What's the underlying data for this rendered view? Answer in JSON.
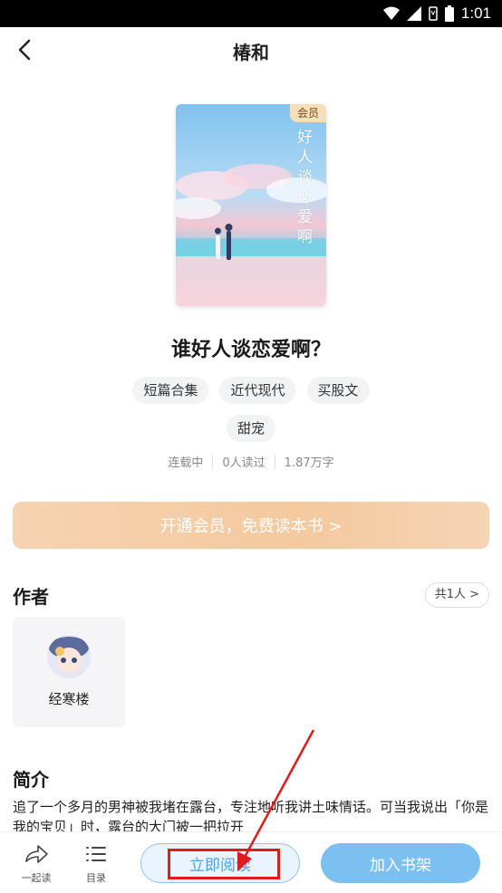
{
  "status_bar": {
    "time": "1:01",
    "icons": [
      "wifi-icon",
      "signal-icon",
      "sim-icon",
      "battery-icon"
    ]
  },
  "header": {
    "title": "椿和",
    "back_icon": "back-arrow-icon"
  },
  "book": {
    "cover_badge": "会员",
    "cover_title_vertical": "好人谈恋爱啊",
    "title": "谁好人谈恋爱啊？",
    "tags": [
      "短篇合集",
      "近代现代",
      "买股文",
      "甜宠"
    ],
    "meta": {
      "status": "连载中",
      "readers": "0人读过",
      "words": "1.87万字"
    }
  },
  "vip_banner": {
    "label": "开通会员，免费读本书 >"
  },
  "author_section": {
    "title": "作者",
    "count_label": "共1人 >",
    "authors": [
      {
        "name": "经寒楼"
      }
    ]
  },
  "intro_section": {
    "title": "简介",
    "text": "追了一个多月的男神被我堵在露台，专注地听我讲土味情话。可当我说出「你是我的宝贝」时，露台的大门被一把拉开"
  },
  "bottom_bar": {
    "share_label": "一起读",
    "catalog_label": "目录",
    "read_label": "立即阅读",
    "shelf_label": "加入书架"
  },
  "colors": {
    "accent": "#4aa0e6",
    "shelf": "#7cc0f2",
    "vip": "#f4c99e",
    "annotation": "#e01b1b"
  }
}
